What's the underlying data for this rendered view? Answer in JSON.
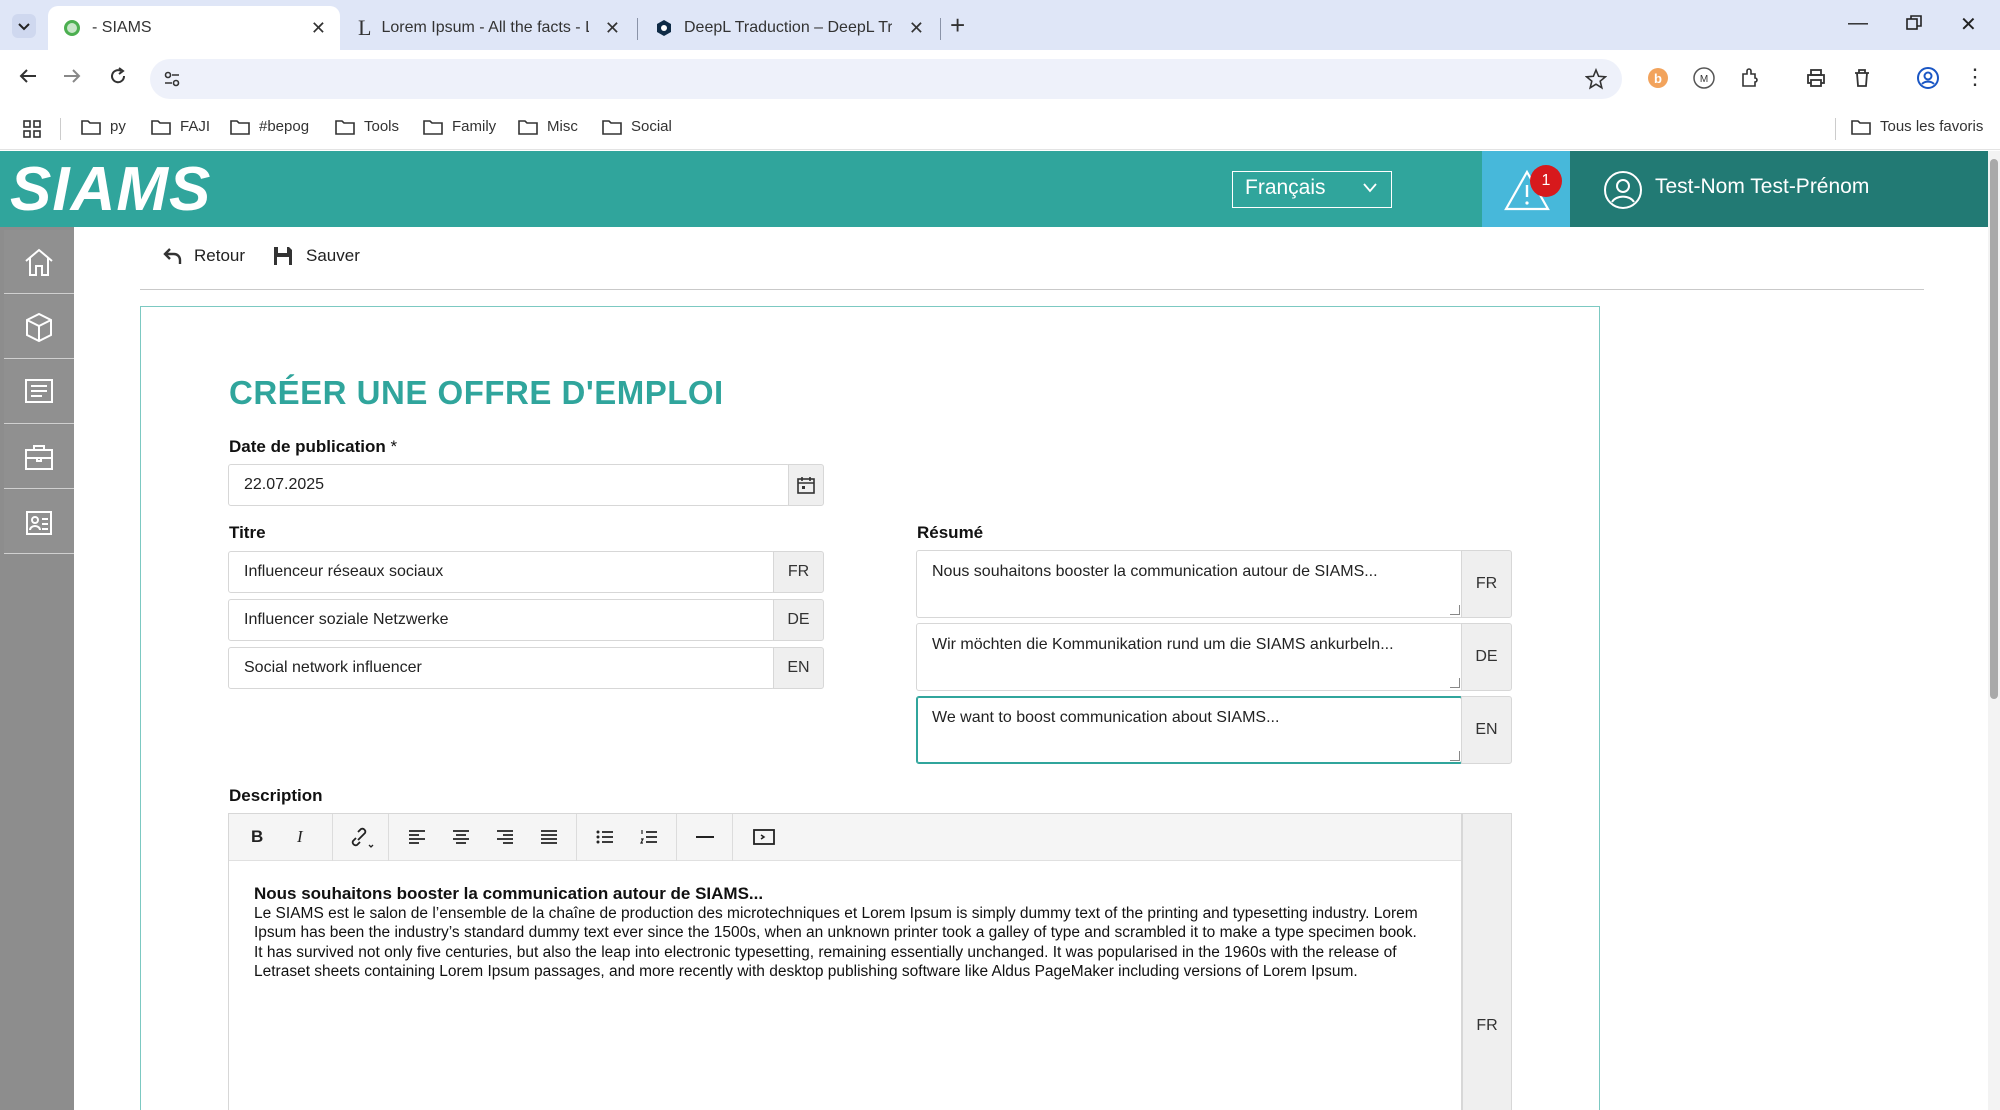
{
  "browser": {
    "tabs": [
      {
        "label": "- SIAMS",
        "active": true
      },
      {
        "label": "Lorem Ipsum - All the facts - Lipsum",
        "active": false
      },
      {
        "label": "DeepL Traduction – DeepL Translate",
        "active": false
      }
    ],
    "new_tab": "+",
    "bookmarks": [
      "py",
      "FAJI",
      "#bepog",
      "Tools",
      "Family",
      "Misc",
      "Social"
    ],
    "bookmarks_right": "Tous les favoris"
  },
  "app": {
    "logo": "SIAMS",
    "language": "Français",
    "alerts_count": "1",
    "user_name": "Test-Nom Test-Prénom",
    "actions": {
      "back": "Retour",
      "save": "Sauver"
    }
  },
  "form": {
    "title": "CRÉER UNE OFFRE D'EMPLOI",
    "publication_date": {
      "label": "Date de publication",
      "required_mark": "*",
      "value": "22.07.2025"
    },
    "titre": {
      "label": "Titre",
      "rows": [
        {
          "value": "Influenceur réseaux sociaux",
          "lang": "FR"
        },
        {
          "value": "Influencer soziale Netzwerke",
          "lang": "DE"
        },
        {
          "value": "Social network influencer",
          "lang": "EN"
        }
      ]
    },
    "resume": {
      "label": "Résumé",
      "rows": [
        {
          "value": "Nous souhaitons booster la communication autour de SIAMS...",
          "lang": "FR"
        },
        {
          "value": "Wir möchten die Kommunikation rund um die SIAMS ankurbeln...",
          "lang": "DE"
        },
        {
          "value": "We want to boost communication about SIAMS...",
          "lang": "EN"
        }
      ]
    },
    "description": {
      "label": "Description",
      "heading": "Nous souhaitons booster la communication autour de SIAMS...",
      "body": "Le SIAMS est le salon de l’ensemble de la chaîne de production des microtechniques et Lorem Ipsum is simply dummy text of the printing and typesetting industry. Lorem Ipsum has been the industry’s standard dummy text ever since the 1500s, when an unknown printer took a galley of type and scrambled it to make a type specimen book. It has survived not only five centuries, but also the leap into electronic typesetting, remaining essentially unchanged. It was popularised in the 1960s with the release of Letraset sheets containing Lorem Ipsum passages, and more recently with desktop publishing software like Aldus PageMaker including versions of Lorem Ipsum.",
      "lang": "FR",
      "toolbar": {
        "bold": "B",
        "italic": "I"
      }
    }
  }
}
